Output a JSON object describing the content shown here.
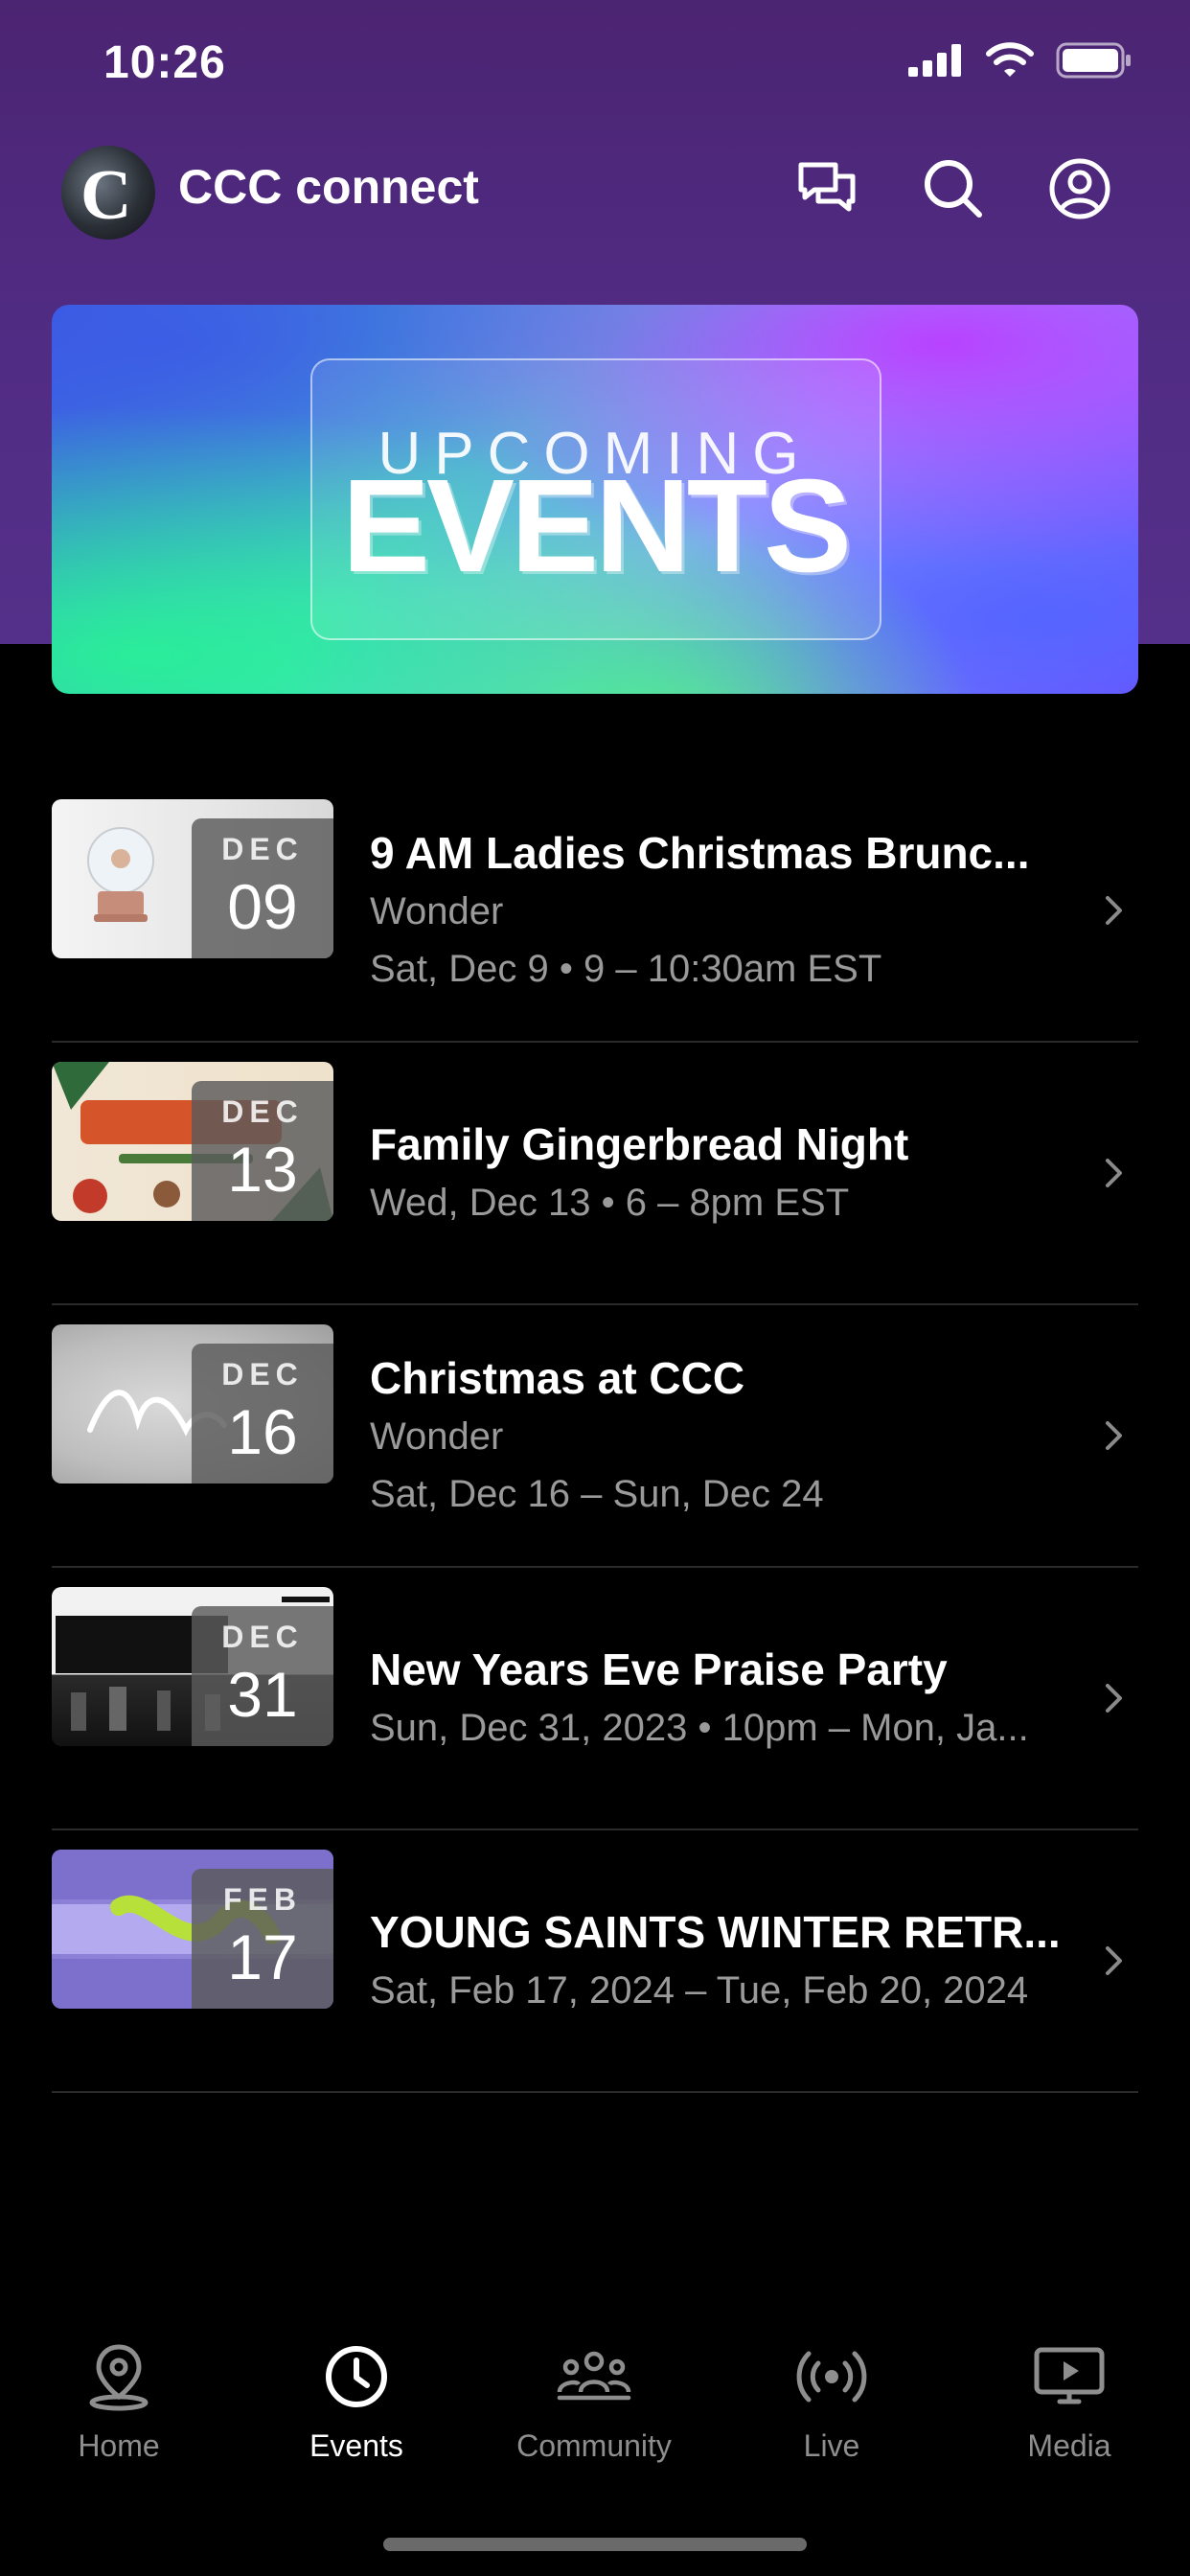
{
  "status_bar": {
    "time": "10:26"
  },
  "header": {
    "app_title": "CCC connect",
    "avatar_letter": "C"
  },
  "banner": {
    "line1": "UPCOMING",
    "line2": "EVENTS"
  },
  "events": [
    {
      "month": "DEC",
      "day": "09",
      "title": "9 AM Ladies Christmas Brunc...",
      "subtitle": "Wonder",
      "when": "Sat, Dec 9 • 9 – 10:30am EST"
    },
    {
      "month": "DEC",
      "day": "13",
      "title": "Family Gingerbread Night",
      "when": "Wed, Dec 13 • 6 – 8pm EST"
    },
    {
      "month": "DEC",
      "day": "16",
      "title": "Christmas at CCC",
      "subtitle": "Wonder",
      "when": "Sat, Dec 16 – Sun, Dec 24"
    },
    {
      "month": "DEC",
      "day": "31",
      "title": "New Years Eve Praise Party",
      "when": "Sun, Dec 31, 2023 • 10pm – Mon, Ja..."
    },
    {
      "month": "FEB",
      "day": "17",
      "title": "YOUNG SAINTS WINTER RETR...",
      "when": "Sat, Feb 17, 2024 – Tue, Feb 20, 2024"
    }
  ],
  "tabs": [
    {
      "label": "Home",
      "icon": "map-pin-icon"
    },
    {
      "label": "Events",
      "icon": "clock-icon",
      "active": true
    },
    {
      "label": "Community",
      "icon": "group-icon"
    },
    {
      "label": "Live",
      "icon": "broadcast-icon"
    },
    {
      "label": "Media",
      "icon": "monitor-play-icon"
    }
  ],
  "colors": {
    "header_purple": "#512c84",
    "background": "#000000",
    "muted_text": "#9a9a9a",
    "tab_inactive": "#8e8e8e"
  }
}
